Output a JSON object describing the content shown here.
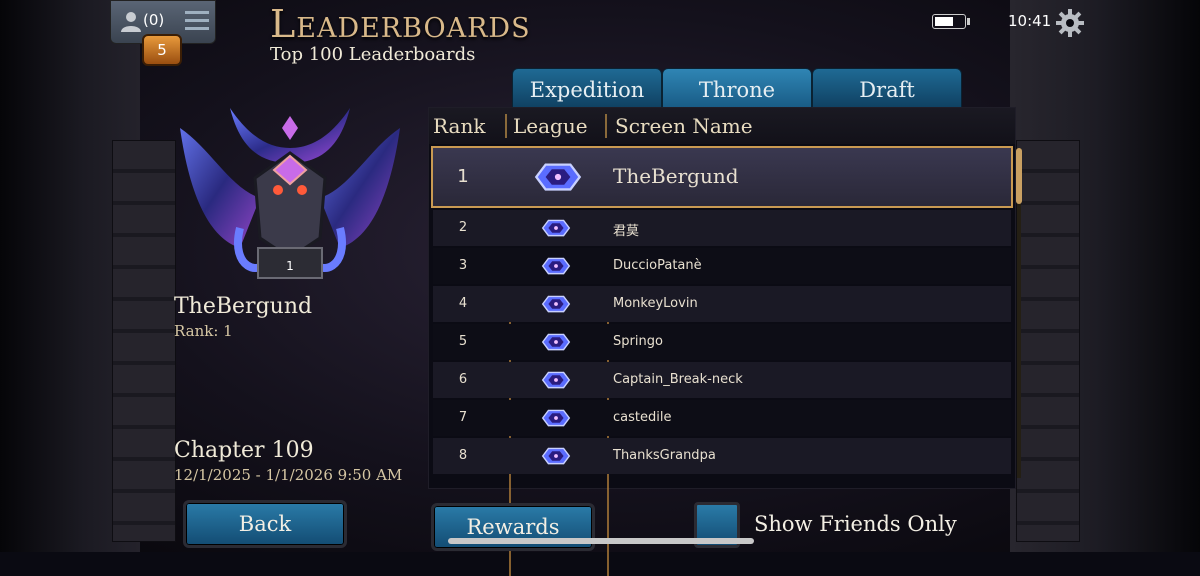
{
  "header": {
    "title": "Leaderboards",
    "subtitle": "Top 100 Leaderboards",
    "friend_count": "(0)",
    "notification_count": "5",
    "clock": "10:41"
  },
  "tabs": [
    {
      "label": "Expedition",
      "active": false
    },
    {
      "label": "Throne",
      "active": true
    },
    {
      "label": "Draft",
      "active": false
    }
  ],
  "player": {
    "name": "TheBergund",
    "rank_text": "Rank: 1",
    "emblem_rank": "1",
    "chapter": "Chapter 109",
    "dates": "12/1/2025 - 1/1/2026 9:50 AM"
  },
  "table": {
    "headers": [
      "Rank",
      "League",
      "Screen Name"
    ],
    "rows": [
      {
        "rank": "1",
        "name": "TheBergund"
      },
      {
        "rank": "2",
        "name": "君莫"
      },
      {
        "rank": "3",
        "name": "DuccioPatanè"
      },
      {
        "rank": "4",
        "name": "MonkeyLovin"
      },
      {
        "rank": "5",
        "name": "Springo"
      },
      {
        "rank": "6",
        "name": "Captain_Break-neck"
      },
      {
        "rank": "7",
        "name": "castedile"
      },
      {
        "rank": "8",
        "name": "ThanksGrandpa"
      }
    ]
  },
  "buttons": {
    "back": "Back",
    "rewards": "Rewards",
    "show_friends": "Show Friends Only"
  },
  "colors": {
    "accent_gold": "#c99a52",
    "button_blue": "#1f6a94"
  }
}
